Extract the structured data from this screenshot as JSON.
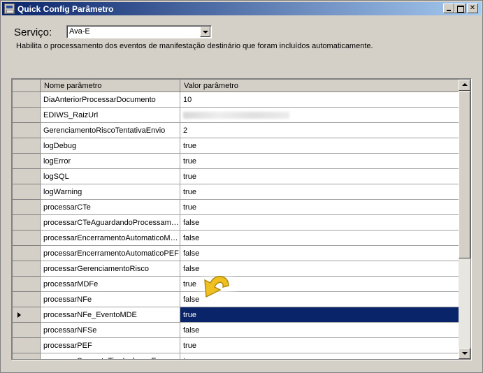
{
  "window": {
    "title": "Quick Config Parâmetro",
    "icon": "app-window-icon"
  },
  "service": {
    "label": "Serviço:",
    "selected": "Ava-E",
    "description": "Habilita o processamento dos eventos de manifestação destinário que foram incluídos automaticamente."
  },
  "grid": {
    "columns": [
      "Nome parâmetro",
      "Valor parâmetro"
    ],
    "selected_row_index": 14,
    "rows": [
      {
        "name": "DiaAnteriorProcessarDocumento",
        "value": "10"
      },
      {
        "name": "EDIWS_RaizUrl",
        "value": ""
      },
      {
        "name": "GerenciamentoRiscoTentativaEnvio",
        "value": "2"
      },
      {
        "name": "logDebug",
        "value": "true"
      },
      {
        "name": "logError",
        "value": "true"
      },
      {
        "name": "logSQL",
        "value": "true"
      },
      {
        "name": "logWarning",
        "value": "true"
      },
      {
        "name": "processarCTe",
        "value": "true"
      },
      {
        "name": "processarCTeAguardandoProcessamento",
        "value": "false"
      },
      {
        "name": "processarEncerramentoAutomaticoMDFe",
        "value": "false"
      },
      {
        "name": "processarEncerramentoAutomaticoPEF",
        "value": "false"
      },
      {
        "name": "processarGerenciamentoRisco",
        "value": "false"
      },
      {
        "name": "processarMDFe",
        "value": "true"
      },
      {
        "name": "processarNFe",
        "value": "false"
      },
      {
        "name": "processarNFe_EventoMDE",
        "value": "true"
      },
      {
        "name": "processarNFSe",
        "value": "false"
      },
      {
        "name": "processarPEF",
        "value": "true"
      },
      {
        "name": "processarSomenteTipoInclusaoEspecifico",
        "value": "true"
      }
    ]
  },
  "colors": {
    "selection": "#0a246a",
    "titlebar_start": "#0a246a",
    "titlebar_end": "#a6caf0",
    "cursor_yellow": "#f0c020"
  }
}
